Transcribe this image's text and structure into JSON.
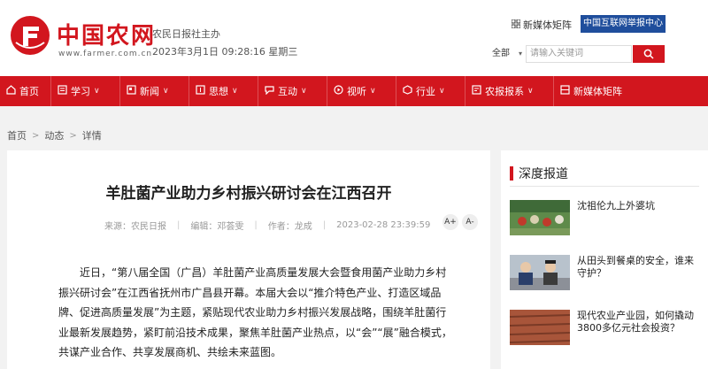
{
  "header": {
    "logo_text": "中国农网",
    "logo_url": "www.farmer.com.cn",
    "org": "农民日报社主办",
    "datetime": "2023年3月1日 09:28:16 星期三",
    "media_matrix": "新媒体矩阵",
    "report_center": "中国互联网举报中心",
    "search_scope": "全部",
    "search_placeholder": "请输入关键词"
  },
  "nav": [
    {
      "label": "首页",
      "icon": "home-icon"
    },
    {
      "label": "学习",
      "icon": "book-icon"
    },
    {
      "label": "新闻",
      "icon": "news-icon"
    },
    {
      "label": "思想",
      "icon": "thought-icon"
    },
    {
      "label": "互动",
      "icon": "chat-icon"
    },
    {
      "label": "视听",
      "icon": "play-icon"
    },
    {
      "label": "行业",
      "icon": "cube-icon"
    },
    {
      "label": "农报报系",
      "icon": "paper-icon"
    },
    {
      "label": "新媒体矩阵",
      "icon": "grid-icon"
    }
  ],
  "breadcrumb": [
    "首页",
    "动态",
    "详情"
  ],
  "article": {
    "title": "羊肚菌产业助力乡村振兴研讨会在江西召开",
    "source": "来源：农民日报",
    "editor": "编辑：邓荟雯",
    "author": "作者：龙成",
    "time": "2023-02-28 23:39:59",
    "font_up": "A+",
    "font_down": "A-",
    "paragraph": "近日，“第八届全国（广昌）羊肚菌产业高质量发展大会暨食用菌产业助力乡村振兴研讨会”在江西省抚州市广昌县开幕。本届大会以“推介特色产业、打造区域品牌、促进高质量发展”为主题，紧贴现代农业助力乡村振兴发展战略，围绕羊肚菌行业最新发展趋势，紧盯前沿技术成果，聚焦羊肚菌产业热点，以“会”“展”融合模式，共谋产业合作、共享发展商机、共绘未来蓝图。"
  },
  "sidebar": {
    "heading": "深度报道",
    "items": [
      {
        "title": "沈祖伦九上外婆坑"
      },
      {
        "title": "从田头到餐桌的安全，谁来守护？"
      },
      {
        "title": "现代农业产业园，如何撬动3800多亿元社会投资？"
      }
    ]
  },
  "colors": {
    "brand": "#d2161e",
    "report": "#1f4e9c"
  }
}
